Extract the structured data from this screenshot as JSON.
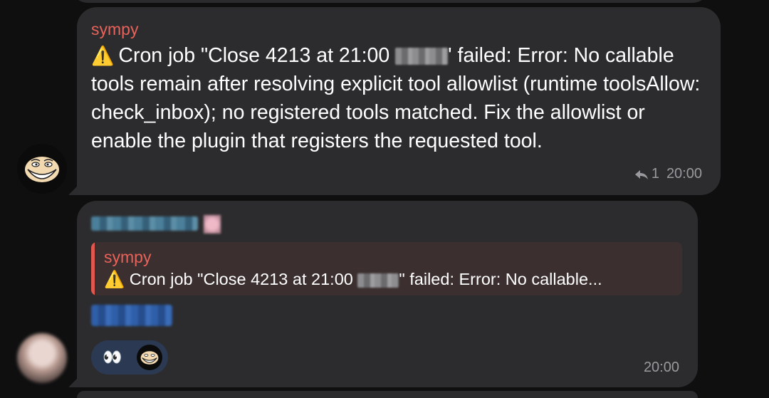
{
  "messages": [
    {
      "sender": "sympy",
      "warning_icon": "warning-icon",
      "text_part1": "Cron job \"Close 4213 at 21:00",
      "text_part2": "' failed: Error: No callable tools remain after resolving explicit tool allowlist (runtime toolsAllow: check_inbox); no registered tools matched. Fix the allowlist or enable the plugin that registers the requested tool.",
      "reply_count": "1",
      "time": "20:00"
    },
    {
      "quote_sender": "sympy",
      "quote_text_part1": "Cron job \"Close 4213 at 21:00",
      "quote_text_part2": "\" failed: Error: No callable...",
      "reaction_emoji": "👀",
      "time": "20:00"
    }
  ],
  "colors": {
    "sender": "#e8625a",
    "bubble": "#2c2c2e",
    "background": "#0f0f10",
    "meta": "#9a9a9e",
    "reaction_bg": "#2b3a52"
  }
}
